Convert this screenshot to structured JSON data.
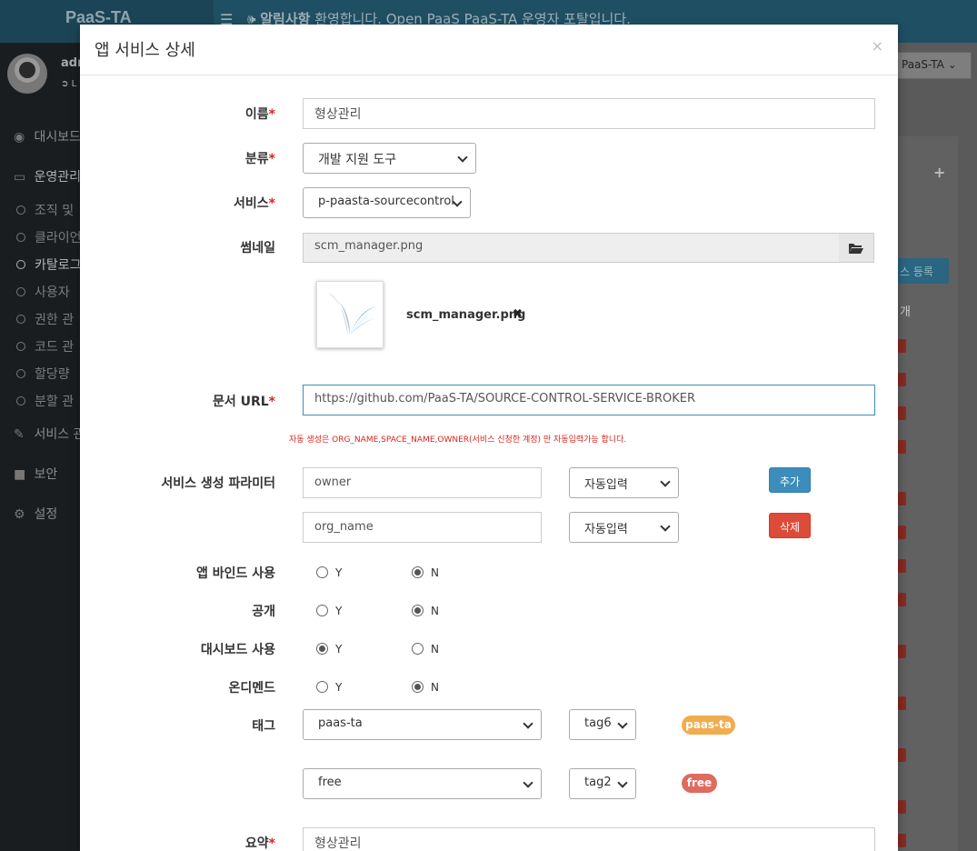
{
  "app": {
    "brand": "PaaS-TA",
    "notice_bold": "알림사항",
    "notice_text": "환영합니다. Open PaaS PaaS-TA 운영자 포탈입니다.",
    "user_name": "adm",
    "logout_label": "L",
    "org_select": "PaaS-TA"
  },
  "sidebar": {
    "items": [
      {
        "label": "대시보드"
      },
      {
        "label": "운영관리"
      },
      {
        "label": "서비스 관"
      },
      {
        "label": "보안"
      },
      {
        "label": "설정"
      }
    ],
    "subitems": [
      {
        "label": "조직 및"
      },
      {
        "label": "클라이언"
      },
      {
        "label": "카탈로그"
      },
      {
        "label": "사용자"
      },
      {
        "label": "권한 관"
      },
      {
        "label": "코드 관"
      },
      {
        "label": "할당량"
      },
      {
        "label": "분할 관"
      }
    ]
  },
  "background": {
    "register_button": "스 등록",
    "count_label": "개"
  },
  "modal": {
    "title": "앱 서비스 상세",
    "close": "×",
    "fields": {
      "name_label": "이름",
      "name_value": "형상관리",
      "category_label": "분류",
      "category_value": "개발 지원 도구",
      "service_label": "서비스",
      "service_value": "p-paasta-sourcecontrol",
      "thumbnail_label": "썸네일",
      "thumbnail_value": "scm_manager.png",
      "thumbnail_file": "scm_manager.png",
      "doc_url_label": "문서 URL",
      "doc_url_value": "https://github.com/PaaS-TA/SOURCE-CONTROL-SERVICE-BROKER",
      "hint": "자동 생성은 ORG_NAME,SPACE_NAME,OWNER(서비스 신청한 계정) 만 자동입력가능 합니다.",
      "params_label": "서비스 생성 파라미터",
      "params": [
        {
          "value": "owner",
          "mode": "자동입력",
          "button": "추가"
        },
        {
          "value": "org_name",
          "mode": "자동입력",
          "button": "삭제"
        }
      ],
      "app_bind_label": "앱 바인드 사용",
      "public_label": "공개",
      "dashboard_label": "대시보드 사용",
      "ondemand_label": "온디멘드",
      "yes": "Y",
      "no": "N",
      "tag_label": "태그",
      "tags": [
        {
          "value": "paas-ta",
          "color_class": "tag6",
          "badge": "paas-ta",
          "badge_color": "#f0ad4e"
        },
        {
          "value": "free",
          "color_class": "tag2",
          "badge": "free",
          "badge_color": "#e06a5e"
        }
      ],
      "summary_label": "요약",
      "summary_value": "형상관리"
    },
    "radios": {
      "app_bind": "N",
      "public": "N",
      "dashboard": "Y",
      "ondemand": "N"
    }
  }
}
